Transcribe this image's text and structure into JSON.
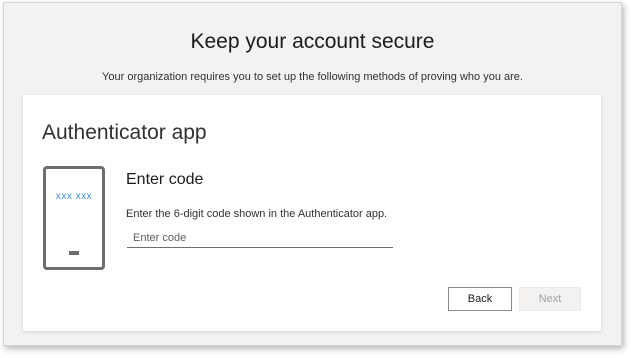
{
  "page": {
    "heading": "Keep your account secure",
    "subheading": "Your organization requires you to set up the following methods of proving who you are."
  },
  "card": {
    "method_title": "Authenticator app",
    "phone_code_placeholder": "xxx xxx",
    "step_title": "Enter code",
    "instructions": "Enter the 6-digit code shown in the Authenticator app.",
    "code_input": {
      "value": "",
      "placeholder": "Enter code"
    },
    "back_label": "Back",
    "next_label": "Next"
  },
  "colors": {
    "accent": "#3a8fd6",
    "page_background": "#f2f2f2",
    "card_background": "#ffffff",
    "disabled_text": "#a19f9d"
  }
}
